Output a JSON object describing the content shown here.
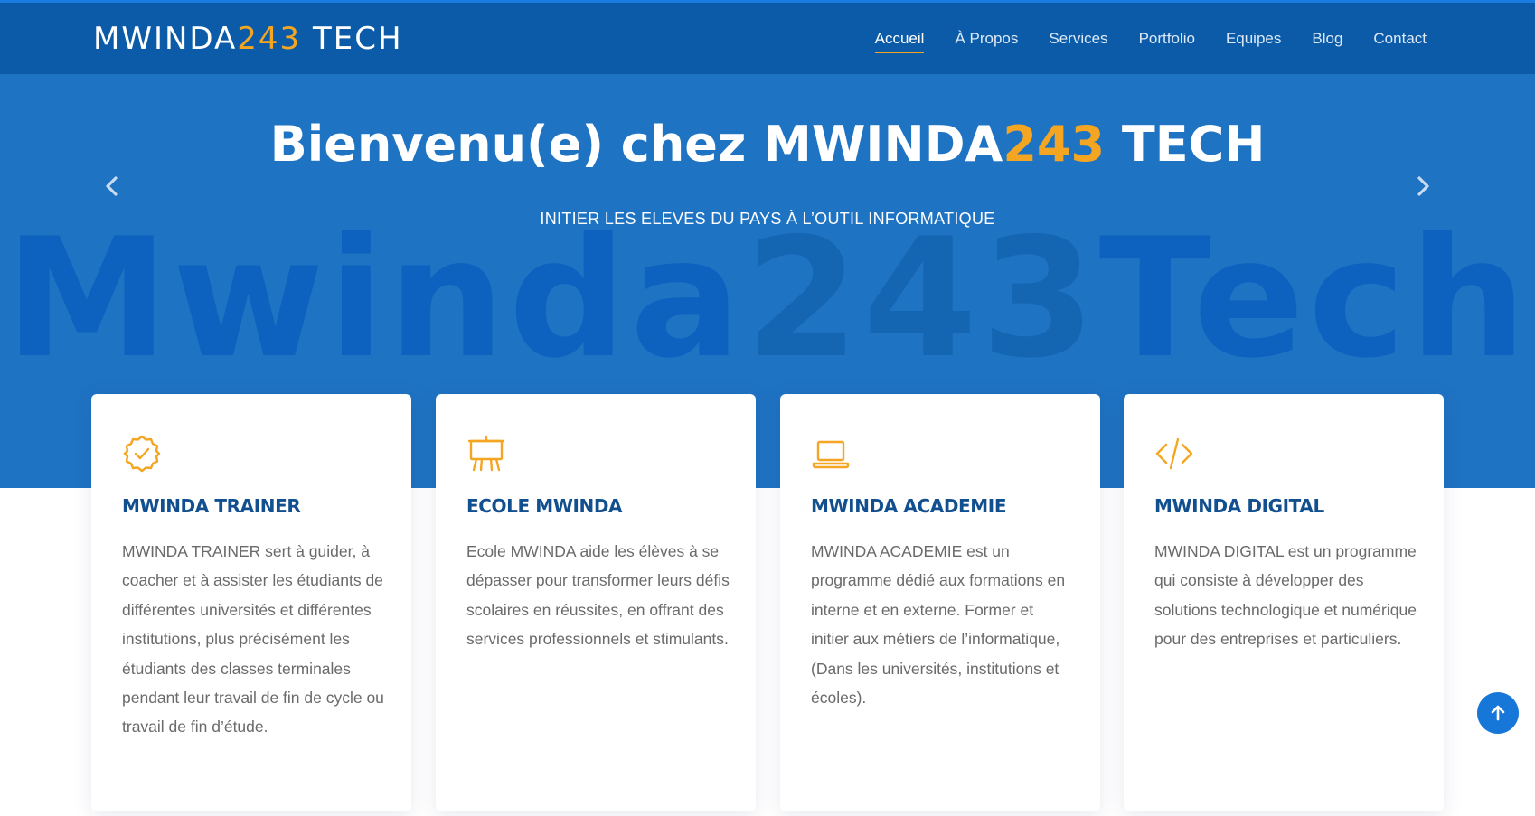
{
  "header": {
    "logo": {
      "part1": "MWINDA",
      "part2": "243",
      "part3": " TECH"
    },
    "nav": [
      {
        "label": "Accueil",
        "active": true
      },
      {
        "label": "À Propos"
      },
      {
        "label": "Services"
      },
      {
        "label": "Portfolio"
      },
      {
        "label": "Equipes"
      },
      {
        "label": "Blog"
      },
      {
        "label": "Contact"
      }
    ]
  },
  "hero": {
    "title_part1": "Bienvenu(e) chez MWINDA",
    "title_part2": "243",
    "title_part3": " TECH",
    "subtitle": "INITIER LES ELEVES DU PAYS À L’OUTIL INFORMATIQUE",
    "watermark_part1": "Mwinda",
    "watermark_part2": "243",
    "watermark_part3": "Tech",
    "prev_icon": "chevron-left-icon",
    "next_icon": "chevron-right-icon"
  },
  "cards": [
    {
      "icon": "badge-check-icon",
      "title": "MWINDA TRAINER",
      "text": "MWINDA TRAINER sert à guider, à coacher et à assister les étudiants de différentes universités et différentes institutions, plus précisément les étudiants des classes terminales pendant leur travail de fin de cycle ou travail de fin d’étude."
    },
    {
      "icon": "easel-icon",
      "title": "ECOLE MWINDA",
      "text": "Ecole MWINDA aide les élèves à se dépasser pour transformer leurs défis scolaires en réussites, en offrant des services professionnels et stimulants."
    },
    {
      "icon": "laptop-icon",
      "title": "MWINDA ACADEMIE",
      "text": "MWINDA ACADEMIE est un programme dédié aux formations en interne et en externe. Former et initier aux métiers de l’informatique, (Dans les universités, institutions et écoles)."
    },
    {
      "icon": "code-icon",
      "title": "MWINDA DIGITAL",
      "text": "MWINDA DIGITAL est un programme qui consiste à développer des solutions technologique et numérique pour des entreprises et particuliers."
    }
  ],
  "back_to_top_icon": "arrow-up-icon",
  "colors": {
    "header_bg": "#0b5ba8",
    "hero_bg": "#1f73c3",
    "accent": "#f4a623",
    "card_title": "#124f8f"
  }
}
